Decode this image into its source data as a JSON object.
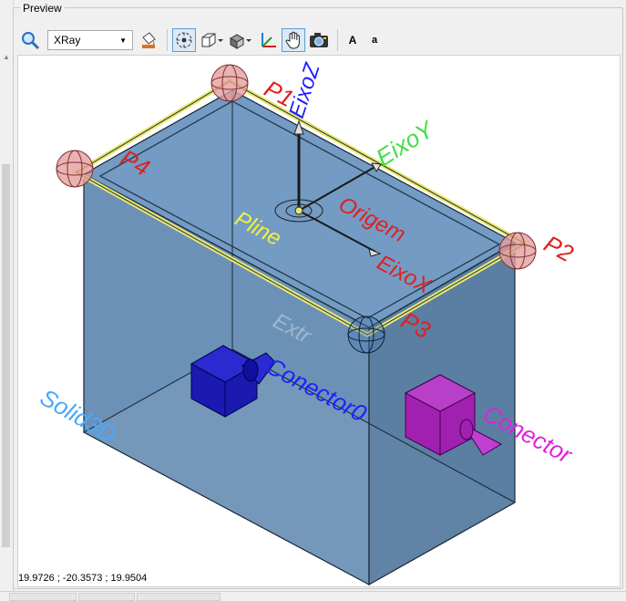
{
  "panel": {
    "title": "Preview"
  },
  "toolbar": {
    "render_mode": "XRay",
    "font_large_label": "A",
    "font_small_label": "a"
  },
  "scene": {
    "labels": {
      "p1": "P1",
      "p2": "P2",
      "p3": "P3",
      "p4": "P4",
      "eixo_z": "EixoZ",
      "eixo_y": "EixoY",
      "eixo_x": "EixoX",
      "origem": "Origem",
      "pline": "Pline",
      "extr": "Extr",
      "solid3d": "Solid3D",
      "conector0": "Conector0",
      "conector": "Conector"
    },
    "colors": {
      "box_fill": "#3f6f9f",
      "point_markers": "#e3a0a0",
      "frame_edge": "#e8e870",
      "label_red": "#e02020",
      "label_green": "#40e040",
      "label_blue": "#2020ff",
      "label_yellow": "#f0f040",
      "label_cyan": "#4aa8ff",
      "cube_blue": "#1a1ab0",
      "cube_magenta": "#a020b0"
    }
  },
  "status": {
    "coordinates": "19.9726 ; -20.3573 ; 19.9504"
  }
}
